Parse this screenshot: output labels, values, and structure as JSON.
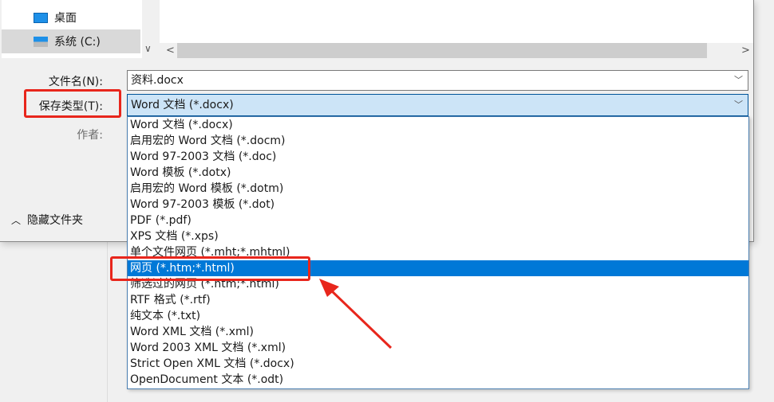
{
  "nav": {
    "items": [
      {
        "label": "桌面",
        "icon": "desktop-icon"
      },
      {
        "label": "系统 (C:)",
        "icon": "drive-icon",
        "selected": true
      }
    ]
  },
  "form": {
    "filename_label": "文件名(N):",
    "filename_value": "资料.docx",
    "savetype_label": "保存类型(T):",
    "savetype_value": "Word 文档 (*.docx)",
    "author_label": "作者:"
  },
  "hide_folders": "隐藏文件夹",
  "options": [
    "Word 文档 (*.docx)",
    "启用宏的 Word 文档 (*.docm)",
    "Word 97-2003 文档 (*.doc)",
    "Word 模板 (*.dotx)",
    "启用宏的 Word 模板 (*.dotm)",
    "Word 97-2003 模板 (*.dot)",
    "PDF (*.pdf)",
    "XPS 文档 (*.xps)",
    "单个文件网页 (*.mht;*.mhtml)",
    "网页 (*.htm;*.html)",
    "筛选过的网页 (*.htm;*.html)",
    "RTF 格式 (*.rtf)",
    "纯文本 (*.txt)",
    "Word XML 文档 (*.xml)",
    "Word 2003 XML 文档 (*.xml)",
    "Strict Open XML 文档 (*.docx)",
    "OpenDocument 文本 (*.odt)"
  ],
  "highlighted_index": 9,
  "colors": {
    "highlight": "#0078d7",
    "annotation": "#e8261c"
  }
}
